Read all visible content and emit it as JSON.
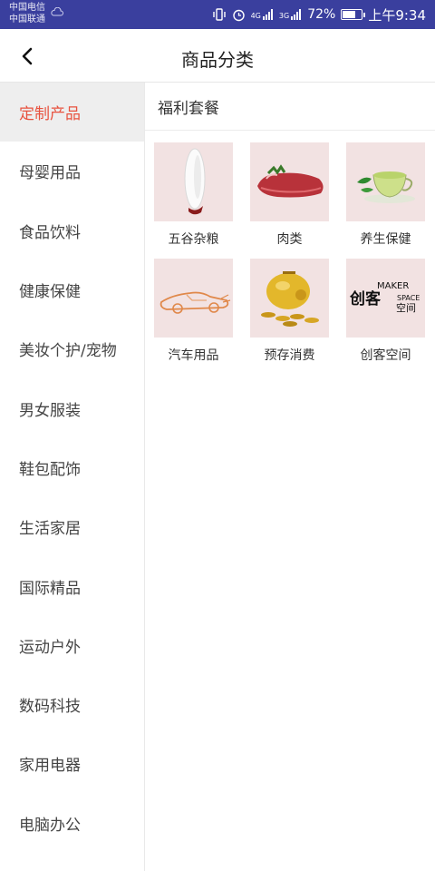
{
  "status_bar": {
    "carrier1": "中国电信",
    "carrier2": "中国联通",
    "network1": "4G",
    "network2": "3G",
    "battery_percent": "72%",
    "battery_level": 0.72,
    "time": "上午9:34"
  },
  "header": {
    "title": "商品分类",
    "back_icon": "chevron-left-icon"
  },
  "sidebar": {
    "items": [
      {
        "label": "定制产品",
        "active": true
      },
      {
        "label": "母婴用品"
      },
      {
        "label": "食品饮料"
      },
      {
        "label": "健康保健"
      },
      {
        "label": "美妆个护/宠物"
      },
      {
        "label": "男女服装"
      },
      {
        "label": "鞋包配饰"
      },
      {
        "label": "生活家居"
      },
      {
        "label": "国际精品"
      },
      {
        "label": "运动户外"
      },
      {
        "label": "数码科技"
      },
      {
        "label": "家用电器"
      },
      {
        "label": "电脑办公"
      }
    ]
  },
  "main": {
    "section_title": "福利套餐",
    "products": [
      {
        "label": "五谷杂粮",
        "image": "rice-grain-image"
      },
      {
        "label": "肉类",
        "image": "meat-image"
      },
      {
        "label": "养生保健",
        "image": "green-tea-image"
      },
      {
        "label": "汽车用品",
        "image": "car-sketch-image"
      },
      {
        "label": "预存消费",
        "image": "piggy-bank-coins-image"
      },
      {
        "label": "创客空间",
        "image": "maker-space-logo-image",
        "logo_text": [
          "MAKER",
          "SPACE",
          "创客",
          "空间"
        ]
      }
    ]
  },
  "colors": {
    "status_bar_bg": "#3a3f9e",
    "active_text": "#e8523f",
    "active_bg": "#eeeeee",
    "thumb_bg": "#f2e2e2"
  }
}
